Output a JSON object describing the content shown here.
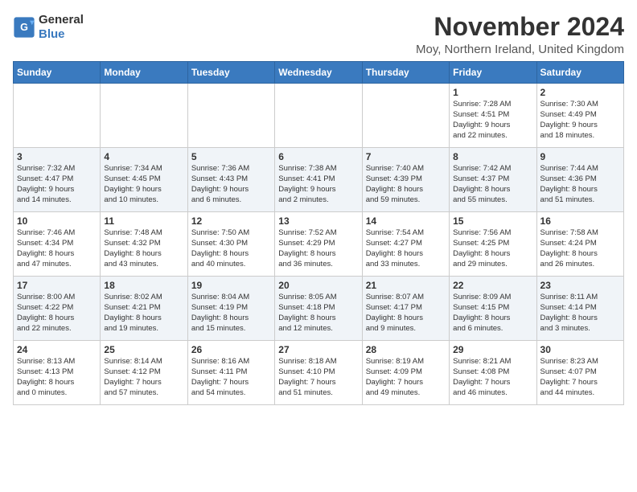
{
  "logo": {
    "line1": "General",
    "line2": "Blue"
  },
  "title": "November 2024",
  "location": "Moy, Northern Ireland, United Kingdom",
  "days_of_week": [
    "Sunday",
    "Monday",
    "Tuesday",
    "Wednesday",
    "Thursday",
    "Friday",
    "Saturday"
  ],
  "weeks": [
    [
      {
        "day": "",
        "content": ""
      },
      {
        "day": "",
        "content": ""
      },
      {
        "day": "",
        "content": ""
      },
      {
        "day": "",
        "content": ""
      },
      {
        "day": "",
        "content": ""
      },
      {
        "day": "1",
        "content": "Sunrise: 7:28 AM\nSunset: 4:51 PM\nDaylight: 9 hours\nand 22 minutes."
      },
      {
        "day": "2",
        "content": "Sunrise: 7:30 AM\nSunset: 4:49 PM\nDaylight: 9 hours\nand 18 minutes."
      }
    ],
    [
      {
        "day": "3",
        "content": "Sunrise: 7:32 AM\nSunset: 4:47 PM\nDaylight: 9 hours\nand 14 minutes."
      },
      {
        "day": "4",
        "content": "Sunrise: 7:34 AM\nSunset: 4:45 PM\nDaylight: 9 hours\nand 10 minutes."
      },
      {
        "day": "5",
        "content": "Sunrise: 7:36 AM\nSunset: 4:43 PM\nDaylight: 9 hours\nand 6 minutes."
      },
      {
        "day": "6",
        "content": "Sunrise: 7:38 AM\nSunset: 4:41 PM\nDaylight: 9 hours\nand 2 minutes."
      },
      {
        "day": "7",
        "content": "Sunrise: 7:40 AM\nSunset: 4:39 PM\nDaylight: 8 hours\nand 59 minutes."
      },
      {
        "day": "8",
        "content": "Sunrise: 7:42 AM\nSunset: 4:37 PM\nDaylight: 8 hours\nand 55 minutes."
      },
      {
        "day": "9",
        "content": "Sunrise: 7:44 AM\nSunset: 4:36 PM\nDaylight: 8 hours\nand 51 minutes."
      }
    ],
    [
      {
        "day": "10",
        "content": "Sunrise: 7:46 AM\nSunset: 4:34 PM\nDaylight: 8 hours\nand 47 minutes."
      },
      {
        "day": "11",
        "content": "Sunrise: 7:48 AM\nSunset: 4:32 PM\nDaylight: 8 hours\nand 43 minutes."
      },
      {
        "day": "12",
        "content": "Sunrise: 7:50 AM\nSunset: 4:30 PM\nDaylight: 8 hours\nand 40 minutes."
      },
      {
        "day": "13",
        "content": "Sunrise: 7:52 AM\nSunset: 4:29 PM\nDaylight: 8 hours\nand 36 minutes."
      },
      {
        "day": "14",
        "content": "Sunrise: 7:54 AM\nSunset: 4:27 PM\nDaylight: 8 hours\nand 33 minutes."
      },
      {
        "day": "15",
        "content": "Sunrise: 7:56 AM\nSunset: 4:25 PM\nDaylight: 8 hours\nand 29 minutes."
      },
      {
        "day": "16",
        "content": "Sunrise: 7:58 AM\nSunset: 4:24 PM\nDaylight: 8 hours\nand 26 minutes."
      }
    ],
    [
      {
        "day": "17",
        "content": "Sunrise: 8:00 AM\nSunset: 4:22 PM\nDaylight: 8 hours\nand 22 minutes."
      },
      {
        "day": "18",
        "content": "Sunrise: 8:02 AM\nSunset: 4:21 PM\nDaylight: 8 hours\nand 19 minutes."
      },
      {
        "day": "19",
        "content": "Sunrise: 8:04 AM\nSunset: 4:19 PM\nDaylight: 8 hours\nand 15 minutes."
      },
      {
        "day": "20",
        "content": "Sunrise: 8:05 AM\nSunset: 4:18 PM\nDaylight: 8 hours\nand 12 minutes."
      },
      {
        "day": "21",
        "content": "Sunrise: 8:07 AM\nSunset: 4:17 PM\nDaylight: 8 hours\nand 9 minutes."
      },
      {
        "day": "22",
        "content": "Sunrise: 8:09 AM\nSunset: 4:15 PM\nDaylight: 8 hours\nand 6 minutes."
      },
      {
        "day": "23",
        "content": "Sunrise: 8:11 AM\nSunset: 4:14 PM\nDaylight: 8 hours\nand 3 minutes."
      }
    ],
    [
      {
        "day": "24",
        "content": "Sunrise: 8:13 AM\nSunset: 4:13 PM\nDaylight: 8 hours\nand 0 minutes."
      },
      {
        "day": "25",
        "content": "Sunrise: 8:14 AM\nSunset: 4:12 PM\nDaylight: 7 hours\nand 57 minutes."
      },
      {
        "day": "26",
        "content": "Sunrise: 8:16 AM\nSunset: 4:11 PM\nDaylight: 7 hours\nand 54 minutes."
      },
      {
        "day": "27",
        "content": "Sunrise: 8:18 AM\nSunset: 4:10 PM\nDaylight: 7 hours\nand 51 minutes."
      },
      {
        "day": "28",
        "content": "Sunrise: 8:19 AM\nSunset: 4:09 PM\nDaylight: 7 hours\nand 49 minutes."
      },
      {
        "day": "29",
        "content": "Sunrise: 8:21 AM\nSunset: 4:08 PM\nDaylight: 7 hours\nand 46 minutes."
      },
      {
        "day": "30",
        "content": "Sunrise: 8:23 AM\nSunset: 4:07 PM\nDaylight: 7 hours\nand 44 minutes."
      }
    ]
  ]
}
